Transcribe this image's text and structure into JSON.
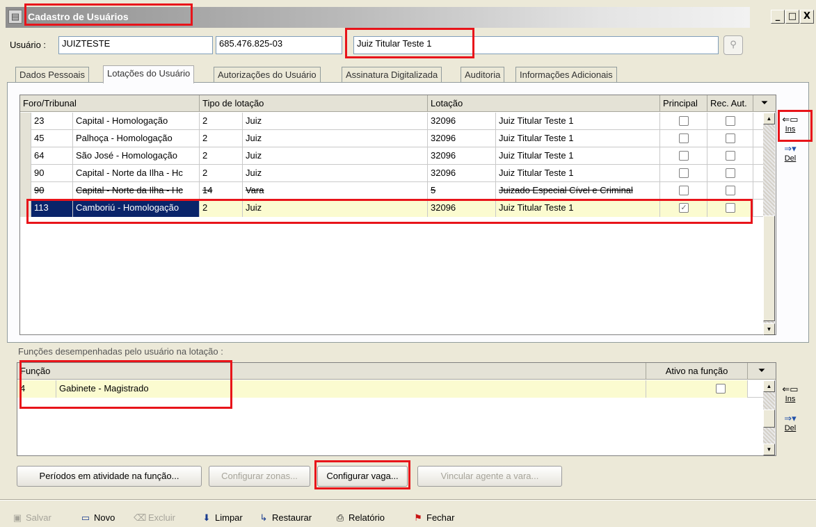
{
  "window": {
    "title": "Cadastro de Usuários",
    "icon": "app-window-icon",
    "controls": [
      "_",
      "□",
      "X"
    ]
  },
  "user": {
    "label": "Usuário :",
    "login": "JUIZTESTE",
    "cpf": "685.476.825-03",
    "name": "Juiz Titular Teste 1",
    "search_icon": "search-icon"
  },
  "tabs": [
    "Dados Pessoais",
    "Lotações do Usuário",
    "Autorizações do Usuário",
    "Assinatura Digitalizada",
    "Auditoria",
    "Informações Adicionais"
  ],
  "lotacoes": {
    "headers": {
      "foro": "Foro/Tribunal",
      "tipo": "Tipo de lotação",
      "lotacao": "Lotação",
      "principal": "Principal",
      "rec_aut": "Rec. Aut."
    },
    "rows": [
      {
        "cod": "23",
        "foro": "Capital - Homologação",
        "tipo_cod": "2",
        "tipo": "Juiz",
        "lot_cod": "32096",
        "lotacao": "Juiz Titular Teste 1",
        "principal": false,
        "rec_aut": false
      },
      {
        "cod": "45",
        "foro": "Palhoça - Homologação",
        "tipo_cod": "2",
        "tipo": "Juiz",
        "lot_cod": "32096",
        "lotacao": "Juiz Titular Teste 1",
        "principal": false,
        "rec_aut": false
      },
      {
        "cod": "64",
        "foro": "São José - Homologação",
        "tipo_cod": "2",
        "tipo": "Juiz",
        "lot_cod": "32096",
        "lotacao": "Juiz Titular Teste 1",
        "principal": false,
        "rec_aut": false
      },
      {
        "cod": "90",
        "foro": "Capital - Norte da Ilha - Hc",
        "tipo_cod": "2",
        "tipo": "Juiz",
        "lot_cod": "32096",
        "lotacao": "Juiz Titular Teste 1",
        "principal": false,
        "rec_aut": false
      },
      {
        "cod": "90",
        "foro": "Capital - Norte da Ilha - Hc",
        "tipo_cod": "14",
        "tipo": "Vara",
        "lot_cod": "5",
        "lotacao": "Juizado Especial Cível e Criminal",
        "principal": false,
        "rec_aut": false,
        "strike": true
      },
      {
        "cod": "113",
        "foro": "Camboriú - Homologação",
        "tipo_cod": "2",
        "tipo": "Juiz",
        "lot_cod": "32096",
        "lotacao": "Juiz Titular Teste 1",
        "principal": true,
        "rec_aut": false,
        "selected": true
      }
    ],
    "ins_label": "Ins",
    "del_label": "Del"
  },
  "funcoes": {
    "caption": "Funções desempenhadas pelo usuário na lotação :",
    "headers": {
      "funcao": "Função",
      "ativo": "Ativo na função"
    },
    "rows": [
      {
        "cod": "4",
        "nome": "Gabinete - Magistrado",
        "ativo": false
      }
    ],
    "ins_label": "Ins",
    "del_label": "Del"
  },
  "buttons": {
    "periodos": "Períodos em atividade na função...",
    "zonas": "Configurar zonas...",
    "vaga": "Configurar vaga...",
    "vincular": "Vincular agente a vara..."
  },
  "toolbar": {
    "salvar": "Salvar",
    "novo": "Novo",
    "excluir": "Excluir",
    "limpar": "Limpar",
    "restaurar": "Restaurar",
    "relatorio": "Relatório",
    "fechar": "Fechar"
  },
  "colors": {
    "annotation": "#e8141a",
    "selection": "#0a246a",
    "row_highlight": "#fbfbd0"
  }
}
